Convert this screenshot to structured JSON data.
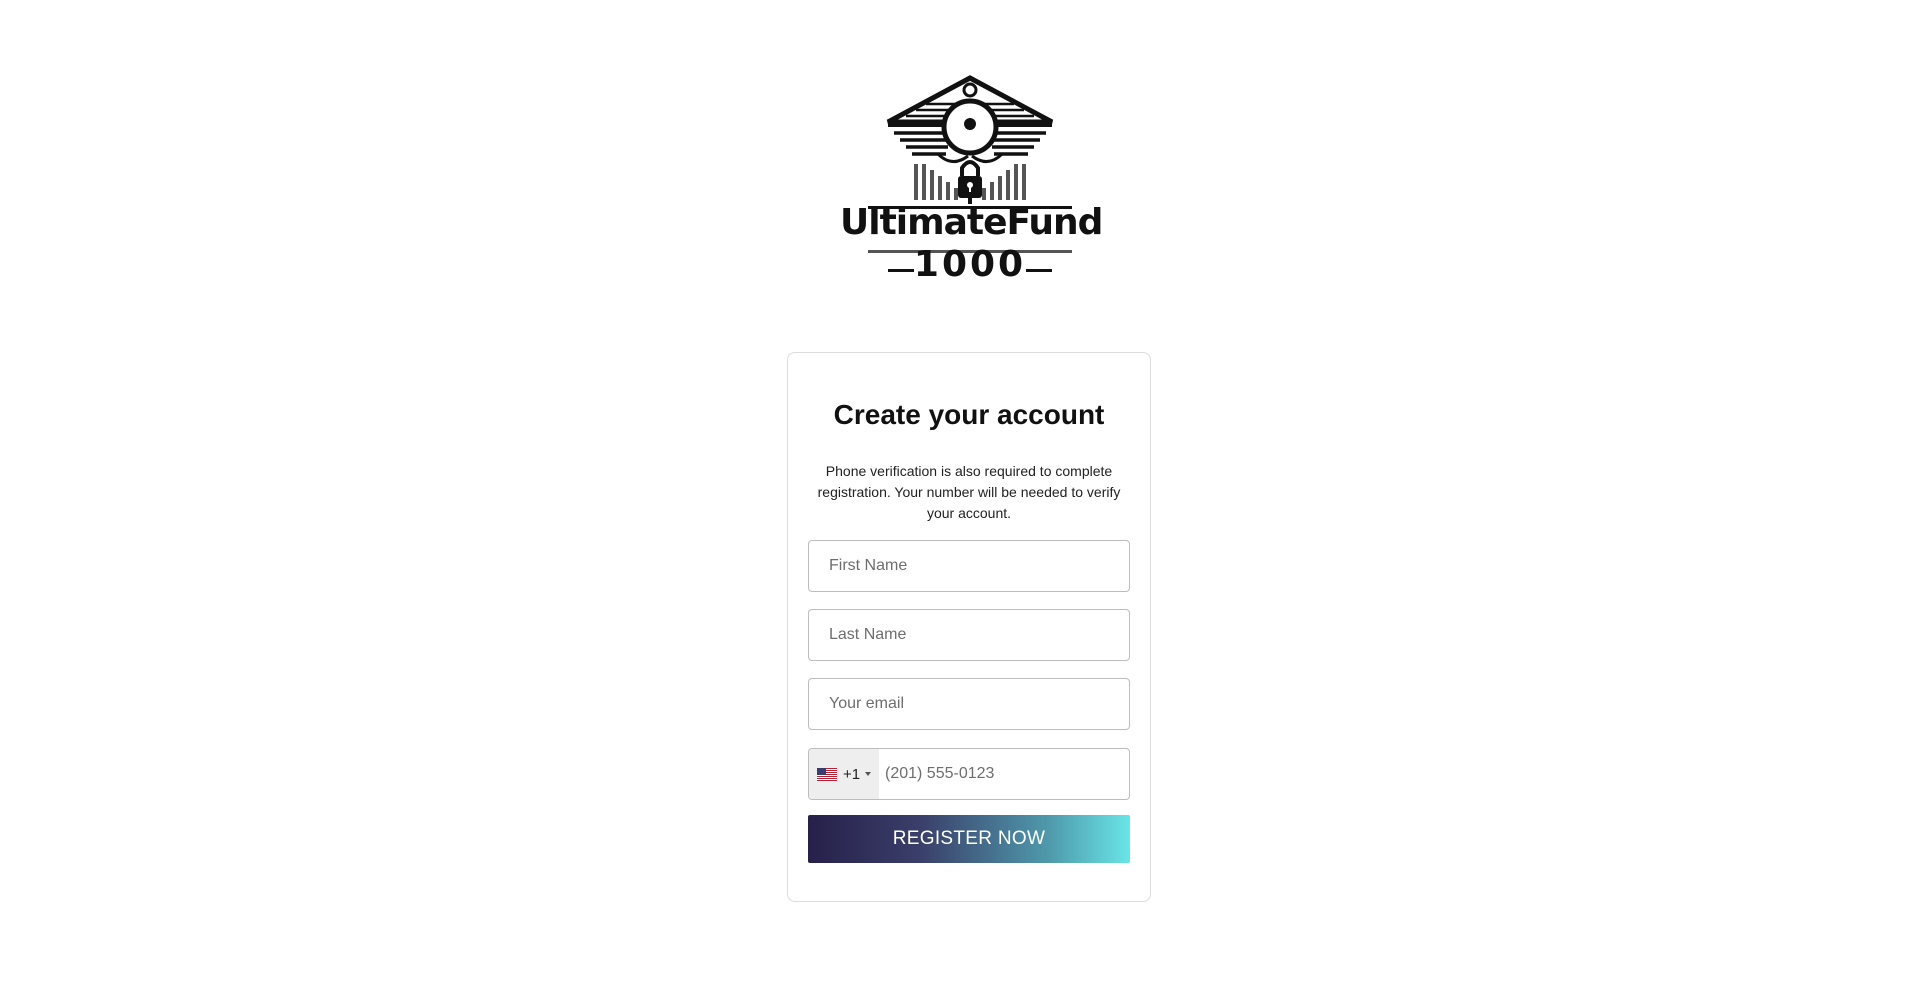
{
  "brand": {
    "name": "UltimateFund",
    "number": "1000",
    "logo_icon": "bank-padlock-logo"
  },
  "form": {
    "title": "Create your account",
    "description": "Phone verification is also required to complete registration. Your number will be needed to verify your account.",
    "first_name_placeholder": "First Name",
    "last_name_placeholder": "Last Name",
    "email_placeholder": "Your email",
    "phone": {
      "country_flag_icon": "us-flag-icon",
      "dial_code": "+1",
      "placeholder": "(201) 555-0123"
    },
    "submit_label": "REGISTER NOW"
  },
  "colors": {
    "button_gradient_start": "#26204a",
    "button_gradient_end": "#69e5e7",
    "card_border": "#dcdcdc"
  }
}
